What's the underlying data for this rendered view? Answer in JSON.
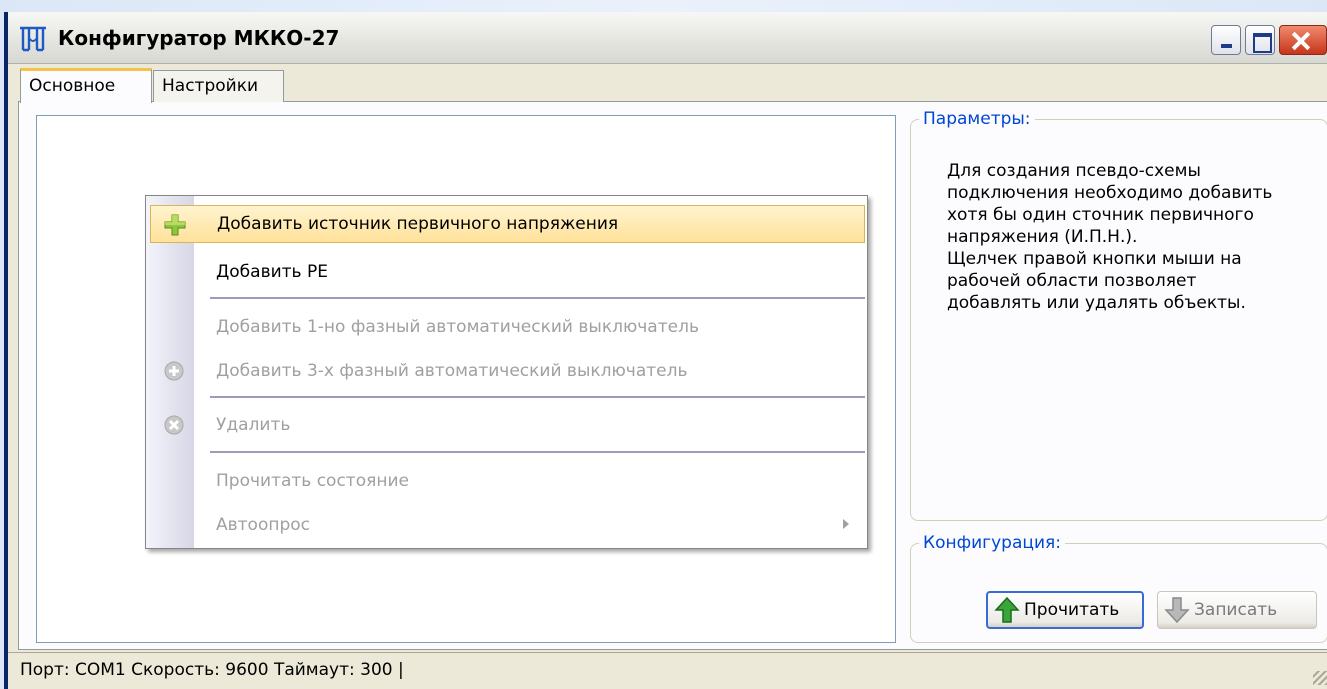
{
  "window": {
    "title": "Конфигуратор МККО-27",
    "controls": [
      "minimize-icon",
      "maximize-icon",
      "close-icon"
    ]
  },
  "tabs": [
    {
      "label": "Основное",
      "active": true
    },
    {
      "label": "Настройки",
      "active": false
    }
  ],
  "parameters": {
    "label": "Параметры:",
    "help_text": "Для создания псевдо-схемы\nподключения необходимо добавить\nхотя бы один сточник первичного\nнапряжения (И.П.Н.).\nЩелчек правой кнопки мыши на\nрабочей области позволяет\nдобавлять или удалять объекты."
  },
  "configuration": {
    "label": "Конфигурация:",
    "read_label": "Прочитать",
    "write_label": "Записать"
  },
  "context_menu": {
    "items": [
      {
        "label": "Добавить источник первичного напряжения",
        "enabled": true,
        "highlighted": true,
        "icon": "plus-icon"
      },
      {
        "label": "Добавить РЕ",
        "enabled": true
      },
      {
        "label": "Добавить 1-но фазный автоматический выключатель",
        "enabled": false
      },
      {
        "label": "Добавить 3-х фазный автоматический выключатель",
        "enabled": false,
        "icon": "add-circle-icon"
      },
      {
        "label": "Удалить",
        "enabled": false,
        "icon": "delete-circle-icon"
      },
      {
        "label": "Прочитать состояние",
        "enabled": false
      },
      {
        "label": "Автоопрос",
        "enabled": false,
        "submenu": true
      }
    ]
  },
  "status": {
    "text": "Порт:  COM1  Скорость:  9600  Таймаут:  300  |"
  }
}
